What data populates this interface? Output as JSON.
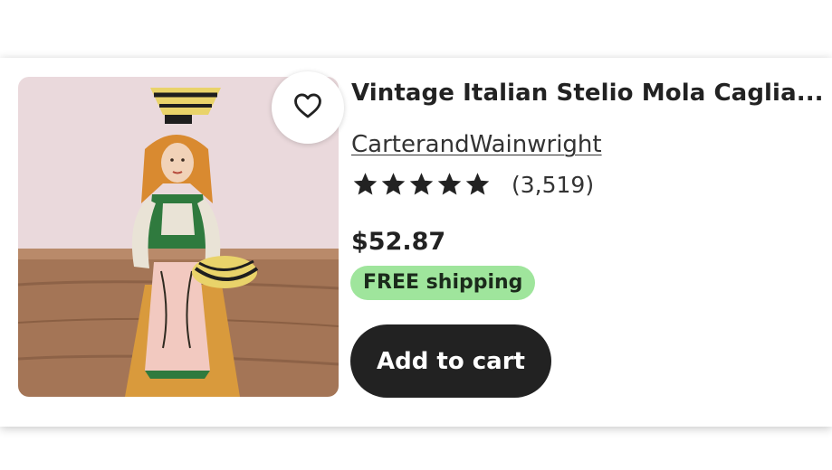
{
  "listing": {
    "title": "Vintage Italian Stelio Mola Caglia...",
    "shop_name": "CarterandWainwright",
    "rating_stars": 5,
    "review_count": "(3,519)",
    "price": "$52.87",
    "shipping_badge": "FREE shipping",
    "add_to_cart_label": "Add to cart",
    "favorite_icon": "heart-outline-icon",
    "star_icon": "star-filled-icon"
  },
  "colors": {
    "text": "#222222",
    "shipping_badge_bg": "#9fe59c",
    "button_bg": "#222222",
    "button_text": "#ffffff"
  }
}
